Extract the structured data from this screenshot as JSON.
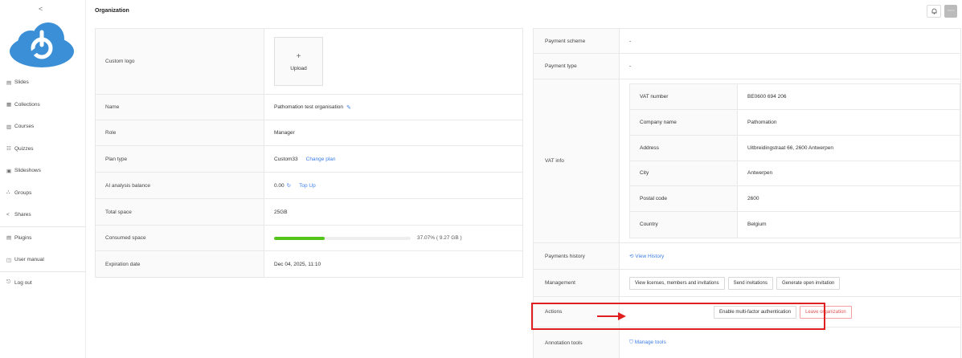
{
  "sidebar": {
    "collapse_icon": "chevron-left-icon",
    "items": [
      {
        "label": "Slides",
        "icon": "▤"
      },
      {
        "label": "Collections",
        "icon": "▦"
      },
      {
        "label": "Courses",
        "icon": "▥"
      },
      {
        "label": "Quizzes",
        "icon": "☷"
      },
      {
        "label": "Slideshows",
        "icon": "▣"
      },
      {
        "label": "Groups",
        "icon": "⛬"
      },
      {
        "label": "Shares",
        "icon": "<"
      },
      {
        "label": "Plugins",
        "icon": "▤"
      },
      {
        "label": "User manual",
        "icon": "◫"
      },
      {
        "label": "Log out",
        "icon": "⎋"
      }
    ]
  },
  "header": {
    "title": "Organization",
    "avatar_text": "~~~"
  },
  "left": {
    "custom_logo_label": "Custom logo",
    "upload_plus": "+",
    "upload_label": "Upload",
    "name_label": "Name",
    "name_value": "Pathomation test organisation",
    "role_label": "Role",
    "role_value": "Manager",
    "plan_label": "Plan type",
    "plan_value": "Custom33",
    "change_plan": "Change plan",
    "ai_label": "AI analysis balance",
    "ai_value": "0.00",
    "top_up": "Top Up",
    "total_space_label": "Total space",
    "total_space_value": "25GB",
    "consumed_label": "Consumed space",
    "consumed_percent": 0.3707,
    "consumed_text": "37.07% ( 9.27 GB )",
    "expiration_label": "Expiration date",
    "expiration_value": "Dec 04, 2025, 11:10"
  },
  "right": {
    "payment_scheme_label": "Payment scheme",
    "payment_scheme_value": "-",
    "payment_type_label": "Payment type",
    "payment_type_value": "-",
    "vat_info_label": "VAT info",
    "vat": {
      "vat_number_label": "VAT number",
      "vat_number_value": "BE0600 694 206",
      "company_label": "Company name",
      "company_value": "Pathomation",
      "address_label": "Address",
      "address_value": "Uitbreidingstraat 66, 2600 Antwerpen",
      "city_label": "City",
      "city_value": "Antwerpen",
      "postal_label": "Postal code",
      "postal_value": "2600",
      "country_label": "Country",
      "country_value": "Belgium"
    },
    "payments_history_label": "Payments history",
    "view_history": "View History",
    "management_label": "Management",
    "btn_view_licenses": "View licenses, members and invitations",
    "btn_send_invitations": "Send invitations",
    "btn_generate_invitation": "Generate open invitation",
    "actions_label": "Actions",
    "btn_mfa": "Enable multi-factor authentication",
    "btn_leave": "Leave organization",
    "annotation_label": "Annotation tools",
    "manage_tools": "Manage tools"
  },
  "colors": {
    "accent": "#3f7fe6",
    "progress": "#52c41a",
    "highlight": "#e02020",
    "danger": "#e05454"
  }
}
